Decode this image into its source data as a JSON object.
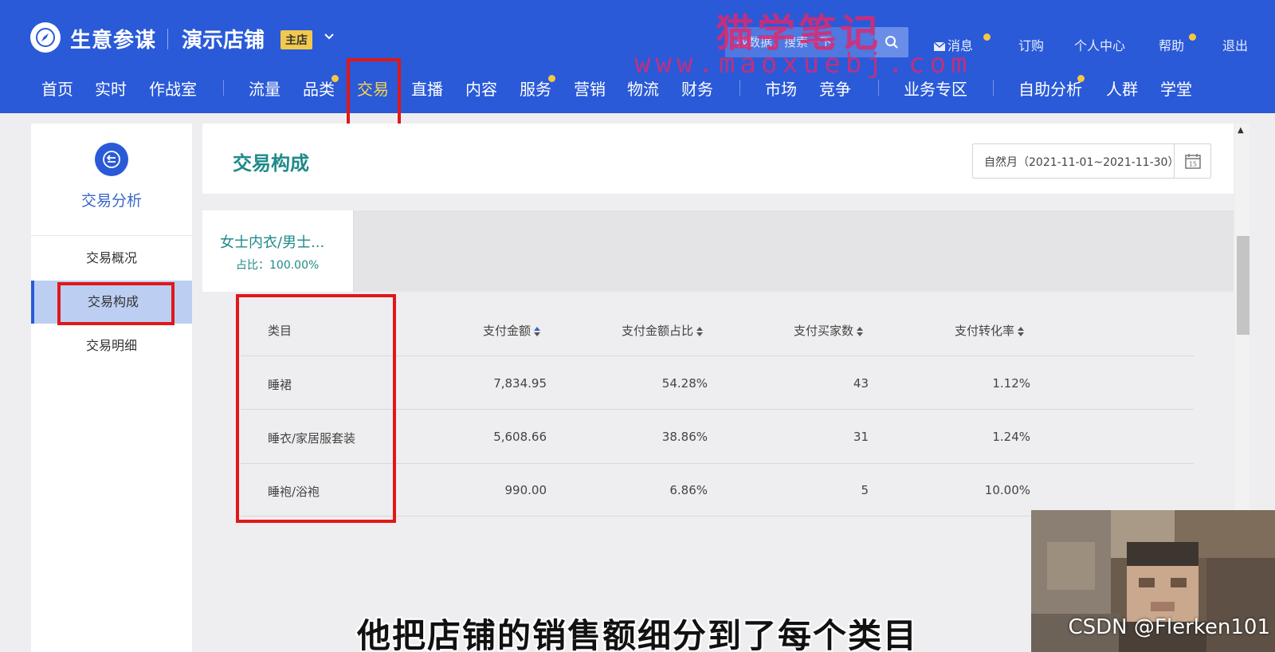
{
  "header": {
    "brand": "生意参谋",
    "shop_name": "演示店铺",
    "shop_badge": "主店",
    "search_placeholder": "找数据，搜索一下",
    "links": [
      "消息",
      "订购",
      "个人中心",
      "帮助",
      "退出"
    ],
    "nav": [
      "首页",
      "实时",
      "作战室",
      "流量",
      "品类",
      "交易",
      "直播",
      "内容",
      "服务",
      "营销",
      "物流",
      "财务",
      "市场",
      "竞争",
      "业务专区",
      "自助分析",
      "人群",
      "学堂"
    ],
    "active_nav": "交易",
    "accent_color": "#2a5ad8"
  },
  "watermark": {
    "line1": "猫学笔记",
    "line2": "www.maoxuebj.com"
  },
  "sidebar": {
    "title": "交易分析",
    "items": [
      "交易概况",
      "交易构成",
      "交易明细"
    ],
    "active_item": "交易构成"
  },
  "main": {
    "title": "交易构成",
    "date_range": "自然月（2021-11-01~2021-11-30）",
    "calendar_day": "15",
    "tab": {
      "name": "女士内衣/男士...",
      "share": "占比：100.00%"
    },
    "table": {
      "columns": [
        "类目",
        "支付金额",
        "支付金额占比",
        "支付买家数",
        "支付转化率"
      ],
      "rows": [
        [
          "睡裙",
          "7,834.95",
          "54.28%",
          "43",
          "1.12%"
        ],
        [
          "睡衣/家居服套装",
          "5,608.66",
          "38.86%",
          "31",
          "1.24%"
        ],
        [
          "睡袍/浴袍",
          "990.00",
          "6.86%",
          "5",
          "10.00%"
        ]
      ]
    }
  },
  "video": {
    "subtitle": "他把店铺的销售额细分到了每个类目",
    "credit": "CSDN @Flerken101"
  }
}
